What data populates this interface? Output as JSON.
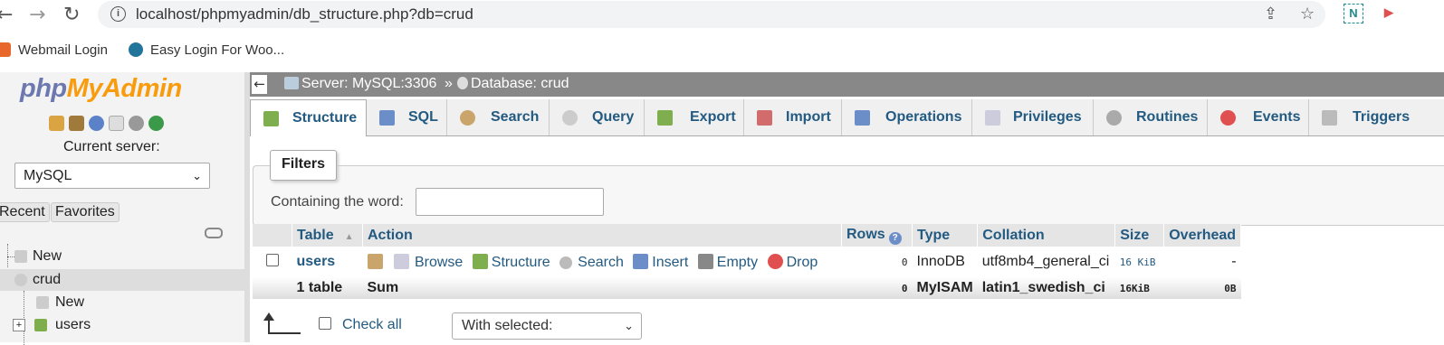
{
  "browser": {
    "url": "localhost/phpmyadmin/db_structure.php?db=crud",
    "bookmarks": [
      {
        "label": "Webmail Login",
        "icon": "webmail-icon"
      },
      {
        "label": "Easy Login For Woo...",
        "icon": "wordpress-icon"
      }
    ]
  },
  "sidebar": {
    "logo_php": "php",
    "logo_myadmin": "MyAdmin",
    "current_server_label": "Current server:",
    "server_value": "MySQL",
    "recent_label": "Recent",
    "favorites_label": "Favorites",
    "tree": [
      {
        "label": "New",
        "level": 0
      },
      {
        "label": "crud",
        "level": 0,
        "selected": true
      },
      {
        "label": "New",
        "level": 1
      },
      {
        "label": "users",
        "level": 1
      }
    ]
  },
  "breadcrumb": {
    "server": "Server: MySQL:3306",
    "separator": "»",
    "database": "Database: crud"
  },
  "tabs": [
    {
      "label": "Structure",
      "icon": "structure-icon",
      "active": true
    },
    {
      "label": "SQL",
      "icon": "sql-icon"
    },
    {
      "label": "Search",
      "icon": "search-icon"
    },
    {
      "label": "Query",
      "icon": "query-icon"
    },
    {
      "label": "Export",
      "icon": "export-icon"
    },
    {
      "label": "Import",
      "icon": "import-icon"
    },
    {
      "label": "Operations",
      "icon": "wrench-icon"
    },
    {
      "label": "Privileges",
      "icon": "privileges-icon"
    },
    {
      "label": "Routines",
      "icon": "routines-icon"
    },
    {
      "label": "Events",
      "icon": "events-icon"
    },
    {
      "label": "Triggers",
      "icon": "triggers-icon"
    }
  ],
  "filters": {
    "legend": "Filters",
    "label": "Containing the word:",
    "value": ""
  },
  "table": {
    "headers": {
      "table": "Table",
      "action": "Action",
      "rows": "Rows",
      "type": "Type",
      "collation": "Collation",
      "size": "Size",
      "overhead": "Overhead"
    },
    "rows": [
      {
        "name": "users",
        "actions": [
          "Browse",
          "Structure",
          "Search",
          "Insert",
          "Empty",
          "Drop"
        ],
        "rows": "0",
        "type": "InnoDB",
        "collation": "utf8mb4_general_ci",
        "size": "16 KiB",
        "overhead": "-"
      }
    ],
    "summary": {
      "name": "1 table",
      "action": "Sum",
      "rows": "0",
      "type": "MyISAM",
      "collation": "latin1_swedish_ci",
      "size": "16KiB",
      "overhead": "0B"
    }
  },
  "bulk": {
    "check_all": "Check all",
    "with_selected": "With selected:"
  }
}
